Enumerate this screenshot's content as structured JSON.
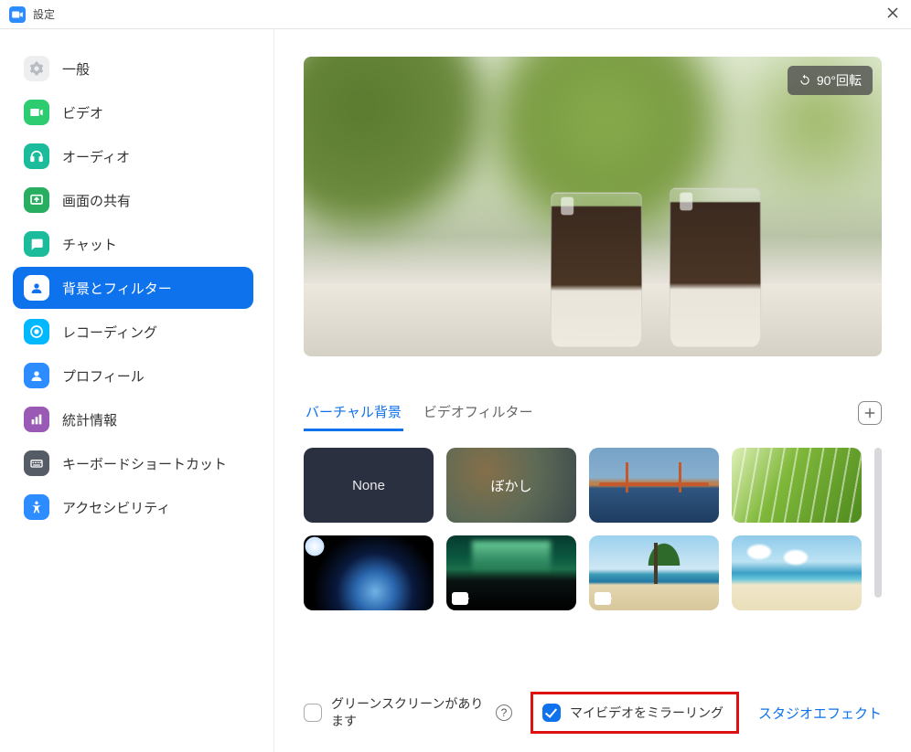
{
  "titlebar": {
    "title": "設定"
  },
  "sidebar": {
    "items": [
      {
        "label": "一般"
      },
      {
        "label": "ビデオ"
      },
      {
        "label": "オーディオ"
      },
      {
        "label": "画面の共有"
      },
      {
        "label": "チャット"
      },
      {
        "label": "背景とフィルター"
      },
      {
        "label": "レコーディング"
      },
      {
        "label": "プロフィール"
      },
      {
        "label": "統計情報"
      },
      {
        "label": "キーボードショートカット"
      },
      {
        "label": "アクセシビリティ"
      }
    ]
  },
  "preview": {
    "rotate_label": "90°回転"
  },
  "tabs": {
    "virtual_bg": "バーチャル背景",
    "video_filters": "ビデオフィルター"
  },
  "bg_tiles": {
    "none": "None",
    "blur": "ぼかし"
  },
  "options": {
    "green_screen": "グリーンスクリーンがあります",
    "mirror_video": "マイビデオをミラーリング",
    "studio_effects": "スタジオエフェクト"
  }
}
